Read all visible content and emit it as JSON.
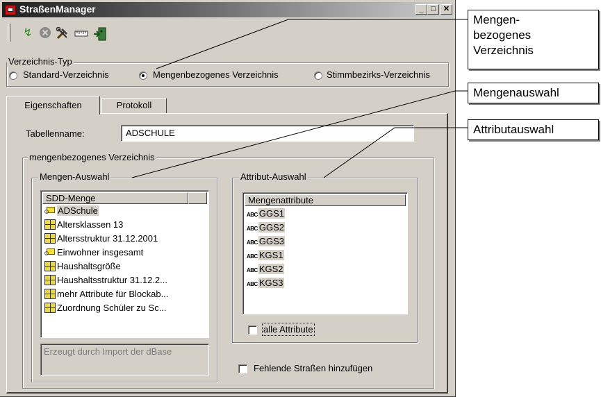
{
  "window": {
    "title": "StraßenManager",
    "caption_buttons": {
      "minimize": "_",
      "maximize": "□",
      "close": "✕"
    }
  },
  "toolbar": {
    "icons": [
      "run-icon",
      "stop-icon",
      "tools-icon",
      "ruler-icon",
      "exit-icon"
    ]
  },
  "verzeichnis_typ": {
    "label": "Verzeichnis-Typ",
    "options": [
      {
        "label": "Standard-Verzeichnis",
        "checked": false
      },
      {
        "label": "Mengenbezogenes Verzeichnis",
        "checked": true
      },
      {
        "label": "Stimmbezirks-Verzeichnis",
        "checked": false
      }
    ]
  },
  "tabs": [
    {
      "label": "Eigenschaften",
      "active": true
    },
    {
      "label": "Protokoll",
      "active": false
    }
  ],
  "tabellenname": {
    "label": "Tabellenname:",
    "value": "ADSCHULE"
  },
  "verzeichnis_group": {
    "label": "mengenbezogenes Verzeichnis"
  },
  "mengen_auswahl": {
    "label": "Mengen-Auswahl",
    "column_header": "SDD-Menge",
    "items": [
      {
        "icon": "link-icon",
        "label": "ADSchule",
        "selected": true
      },
      {
        "icon": "table-icon",
        "label": "Altersklassen 13"
      },
      {
        "icon": "table-icon",
        "label": "Altersstruktur 31.12.2001"
      },
      {
        "icon": "link-icon",
        "label": "Einwohner insgesamt"
      },
      {
        "icon": "table-icon",
        "label": "Haushaltsgröße"
      },
      {
        "icon": "table-icon",
        "label": "Haushaltsstruktur 31.12.2..."
      },
      {
        "icon": "table-icon",
        "label": "mehr Attribute für Blockab..."
      },
      {
        "icon": "table-icon",
        "label": "Zuordnung Schüler zu Sc..."
      }
    ],
    "description": "Erzeugt durch Import der dBase"
  },
  "attribut_auswahl": {
    "label": "Attribut-Auswahl",
    "column_header": "Mengenattribute",
    "type_prefix": "ABC",
    "items": [
      "GGS1",
      "GGS2",
      "GGS3",
      "KGS1",
      "KGS2",
      "KGS3"
    ],
    "alle_attribute": {
      "label": "alle Attribute",
      "checked": false
    }
  },
  "fehlende_strassen": {
    "label": "Fehlende Straßen hinzufügen",
    "checked": false
  },
  "callouts": {
    "mengenbezogenes": "Mengen-\nbezogenes\nVerzeichnis",
    "mengenauswahl": "Mengenauswahl",
    "attributauswahl": "Attributauswahl"
  }
}
